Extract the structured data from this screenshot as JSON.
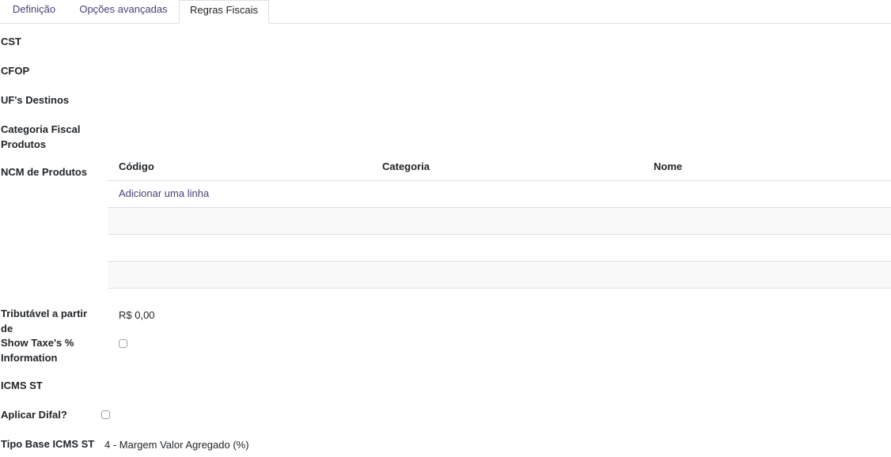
{
  "tabs": [
    {
      "label": "Definição",
      "active": false
    },
    {
      "label": "Opções avançadas",
      "active": false
    },
    {
      "label": "Regras Fiscais",
      "active": true
    }
  ],
  "form": {
    "cst_label": "CST",
    "cfop_label": "CFOP",
    "uf_destinos_label": "UF's Destinos",
    "categoria_fiscal_label_line1": "Categoria Fiscal",
    "categoria_fiscal_label_line2": "Produtos",
    "ncm_label": "NCM de Produtos",
    "tributavel_label": "Tributável a partir de",
    "tributavel_value": "R$ 0,00",
    "show_taxes_label_line1": "Show Taxe's %",
    "show_taxes_label_line2": "Information",
    "show_taxes_checked": false,
    "icms_st_label": "ICMS ST",
    "difal_label": "Aplicar Difal?",
    "difal_checked": false,
    "tipo_base_label": "Tipo Base ICMS ST",
    "tipo_base_value": "4 - Margem Valor Agregado (%)"
  },
  "ncm_table": {
    "columns": [
      "Código",
      "Categoria",
      "Nome"
    ],
    "add_line": "Adicionar uma linha"
  },
  "colors": {
    "accent": "#4c3d7a",
    "border": "#dee2e6",
    "row_alt": "#f9f9fa"
  }
}
